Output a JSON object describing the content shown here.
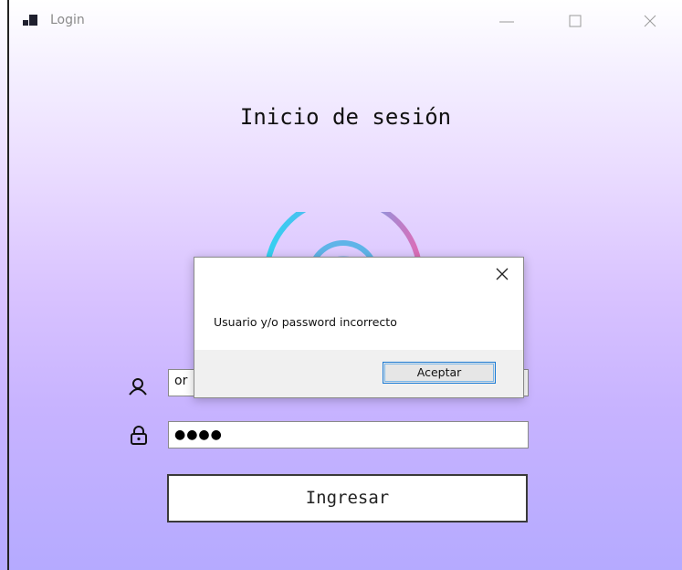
{
  "window": {
    "title": "Login",
    "icon": "window-app-icon"
  },
  "main": {
    "heading": "Inicio de sesión",
    "logo": "fingerprint-logo"
  },
  "form": {
    "username_value": "or",
    "password_masked": "●●●●",
    "submit_label": "Ingresar",
    "user_icon": "user-icon",
    "lock_icon": "lock-icon"
  },
  "dialog": {
    "message": "Usuario y/o password incorrecto",
    "ok_label": "Aceptar"
  },
  "colors": {
    "gradient_top": "#ffffff",
    "gradient_bottom": "#b5aaff",
    "accent_blue": "#1a7ad4",
    "logo_cyan": "#34d1f0",
    "logo_pink": "#e06bb5"
  }
}
